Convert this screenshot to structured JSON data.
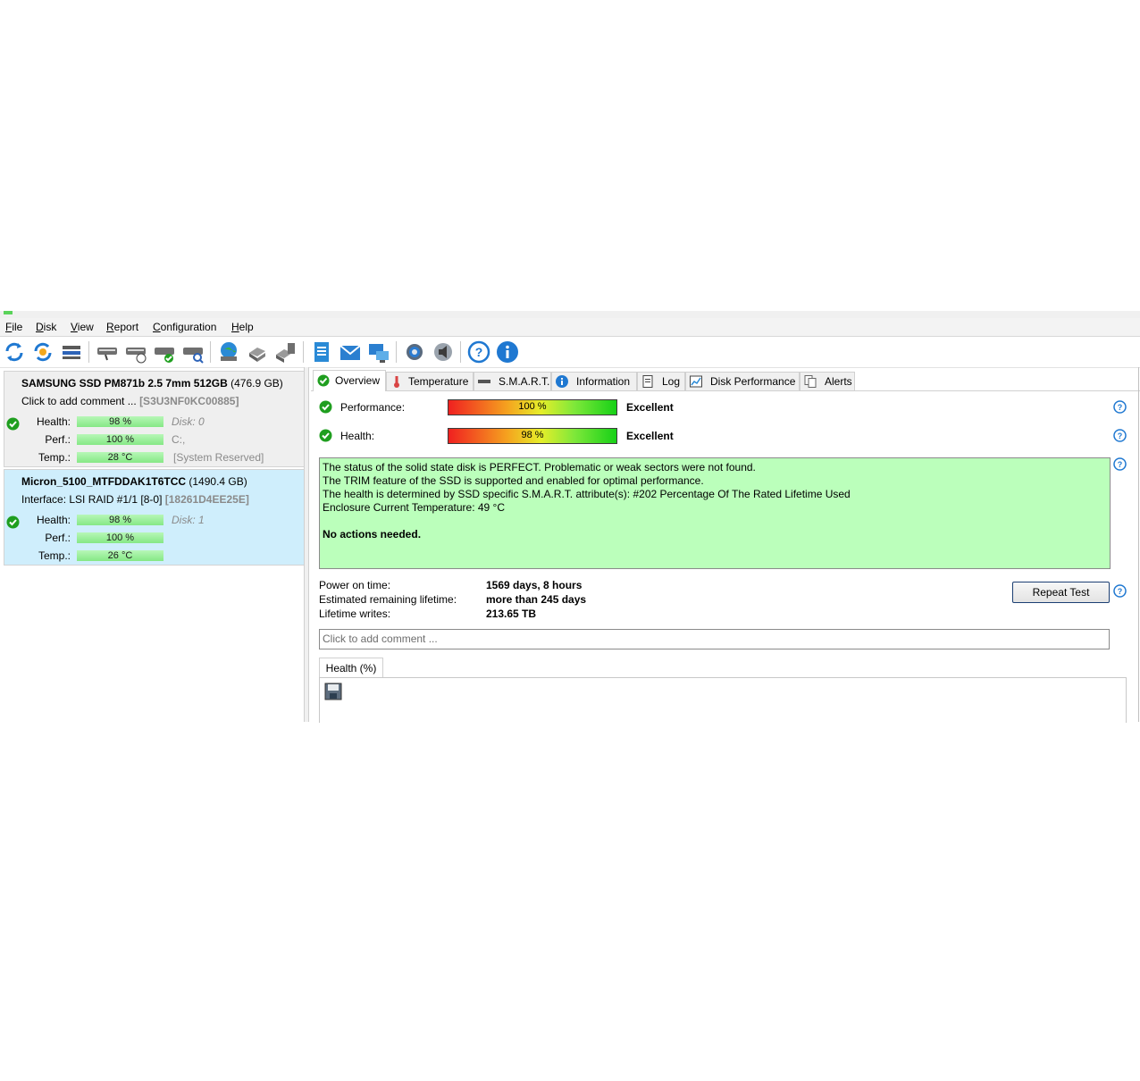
{
  "menu": [
    "File",
    "Disk",
    "View",
    "Report",
    "Configuration",
    "Help"
  ],
  "toolbar_icons": [
    "refresh-icon",
    "refresh-selected-icon",
    "disk-list-icon",
    "short-test-icon",
    "extended-test-icon",
    "verify-test-icon",
    "disk-scan-icon",
    "internet-icon",
    "disk-info-icon",
    "disk-copy-icon",
    "report-icon",
    "email-icon",
    "network-icon",
    "settings-icon",
    "sound-icon",
    "help-icon",
    "about-icon"
  ],
  "disks": [
    {
      "name": "SAMSUNG SSD PM871b 2.5 7mm 512GB",
      "size": "(476.9 GB)",
      "sub_label": "Click to add comment ...",
      "sub_value": "[S3U3NF0KC00885]",
      "health_label": "Health:",
      "health": "98 %",
      "perf_label": "Perf.:",
      "perf": "100 %",
      "temp_label": "Temp.:",
      "temp": "28 °C",
      "side1": "Disk: 0",
      "side2": "C:,",
      "side3": "[System Reserved]"
    },
    {
      "name": "Micron_5100_MTFDDAK1T6TCC",
      "size": "(1490.4 GB)",
      "sub_label": "Interface:  LSI  RAID #1/1 [8-0]",
      "sub_value": "[18261D4EE25E]",
      "health_label": "Health:",
      "health": "98 %",
      "perf_label": "Perf.:",
      "perf": "100 %",
      "temp_label": "Temp.:",
      "temp": "26 °C",
      "side1": "Disk: 1"
    }
  ],
  "tabs": [
    "Overview",
    "Temperature",
    "S.M.A.R.T.",
    "Information",
    "Log",
    "Disk Performance",
    "Alerts"
  ],
  "overview": {
    "performance_label": "Performance:",
    "performance_value": "100 %",
    "performance_rating": "Excellent",
    "health_label": "Health:",
    "health_value": "98 %",
    "health_rating": "Excellent",
    "status_lines": [
      "The status of the solid state disk is PERFECT. Problematic or weak sectors were not found.",
      "The TRIM feature of the SSD is supported and enabled for optimal performance.",
      "The health is determined by SSD specific S.M.A.R.T. attribute(s):  #202 Percentage Of The Rated Lifetime Used",
      "Enclosure Current Temperature: 49 °C"
    ],
    "status_action": "No actions needed.",
    "power_on_label": "Power on time:",
    "power_on_value": "1569 days, 8 hours",
    "remaining_label": "Estimated remaining lifetime:",
    "remaining_value": "more than 245 days",
    "writes_label": "Lifetime writes:",
    "writes_value": "213.65 TB",
    "repeat_test": "Repeat Test",
    "comment_placeholder": "Click to add comment ...",
    "health_chart_tab": "Health (%)"
  },
  "colors": {
    "status_bg": "#bbffbb",
    "selected_disk_bg": "#cfeefc",
    "ok_green": "#1f9e1f"
  }
}
